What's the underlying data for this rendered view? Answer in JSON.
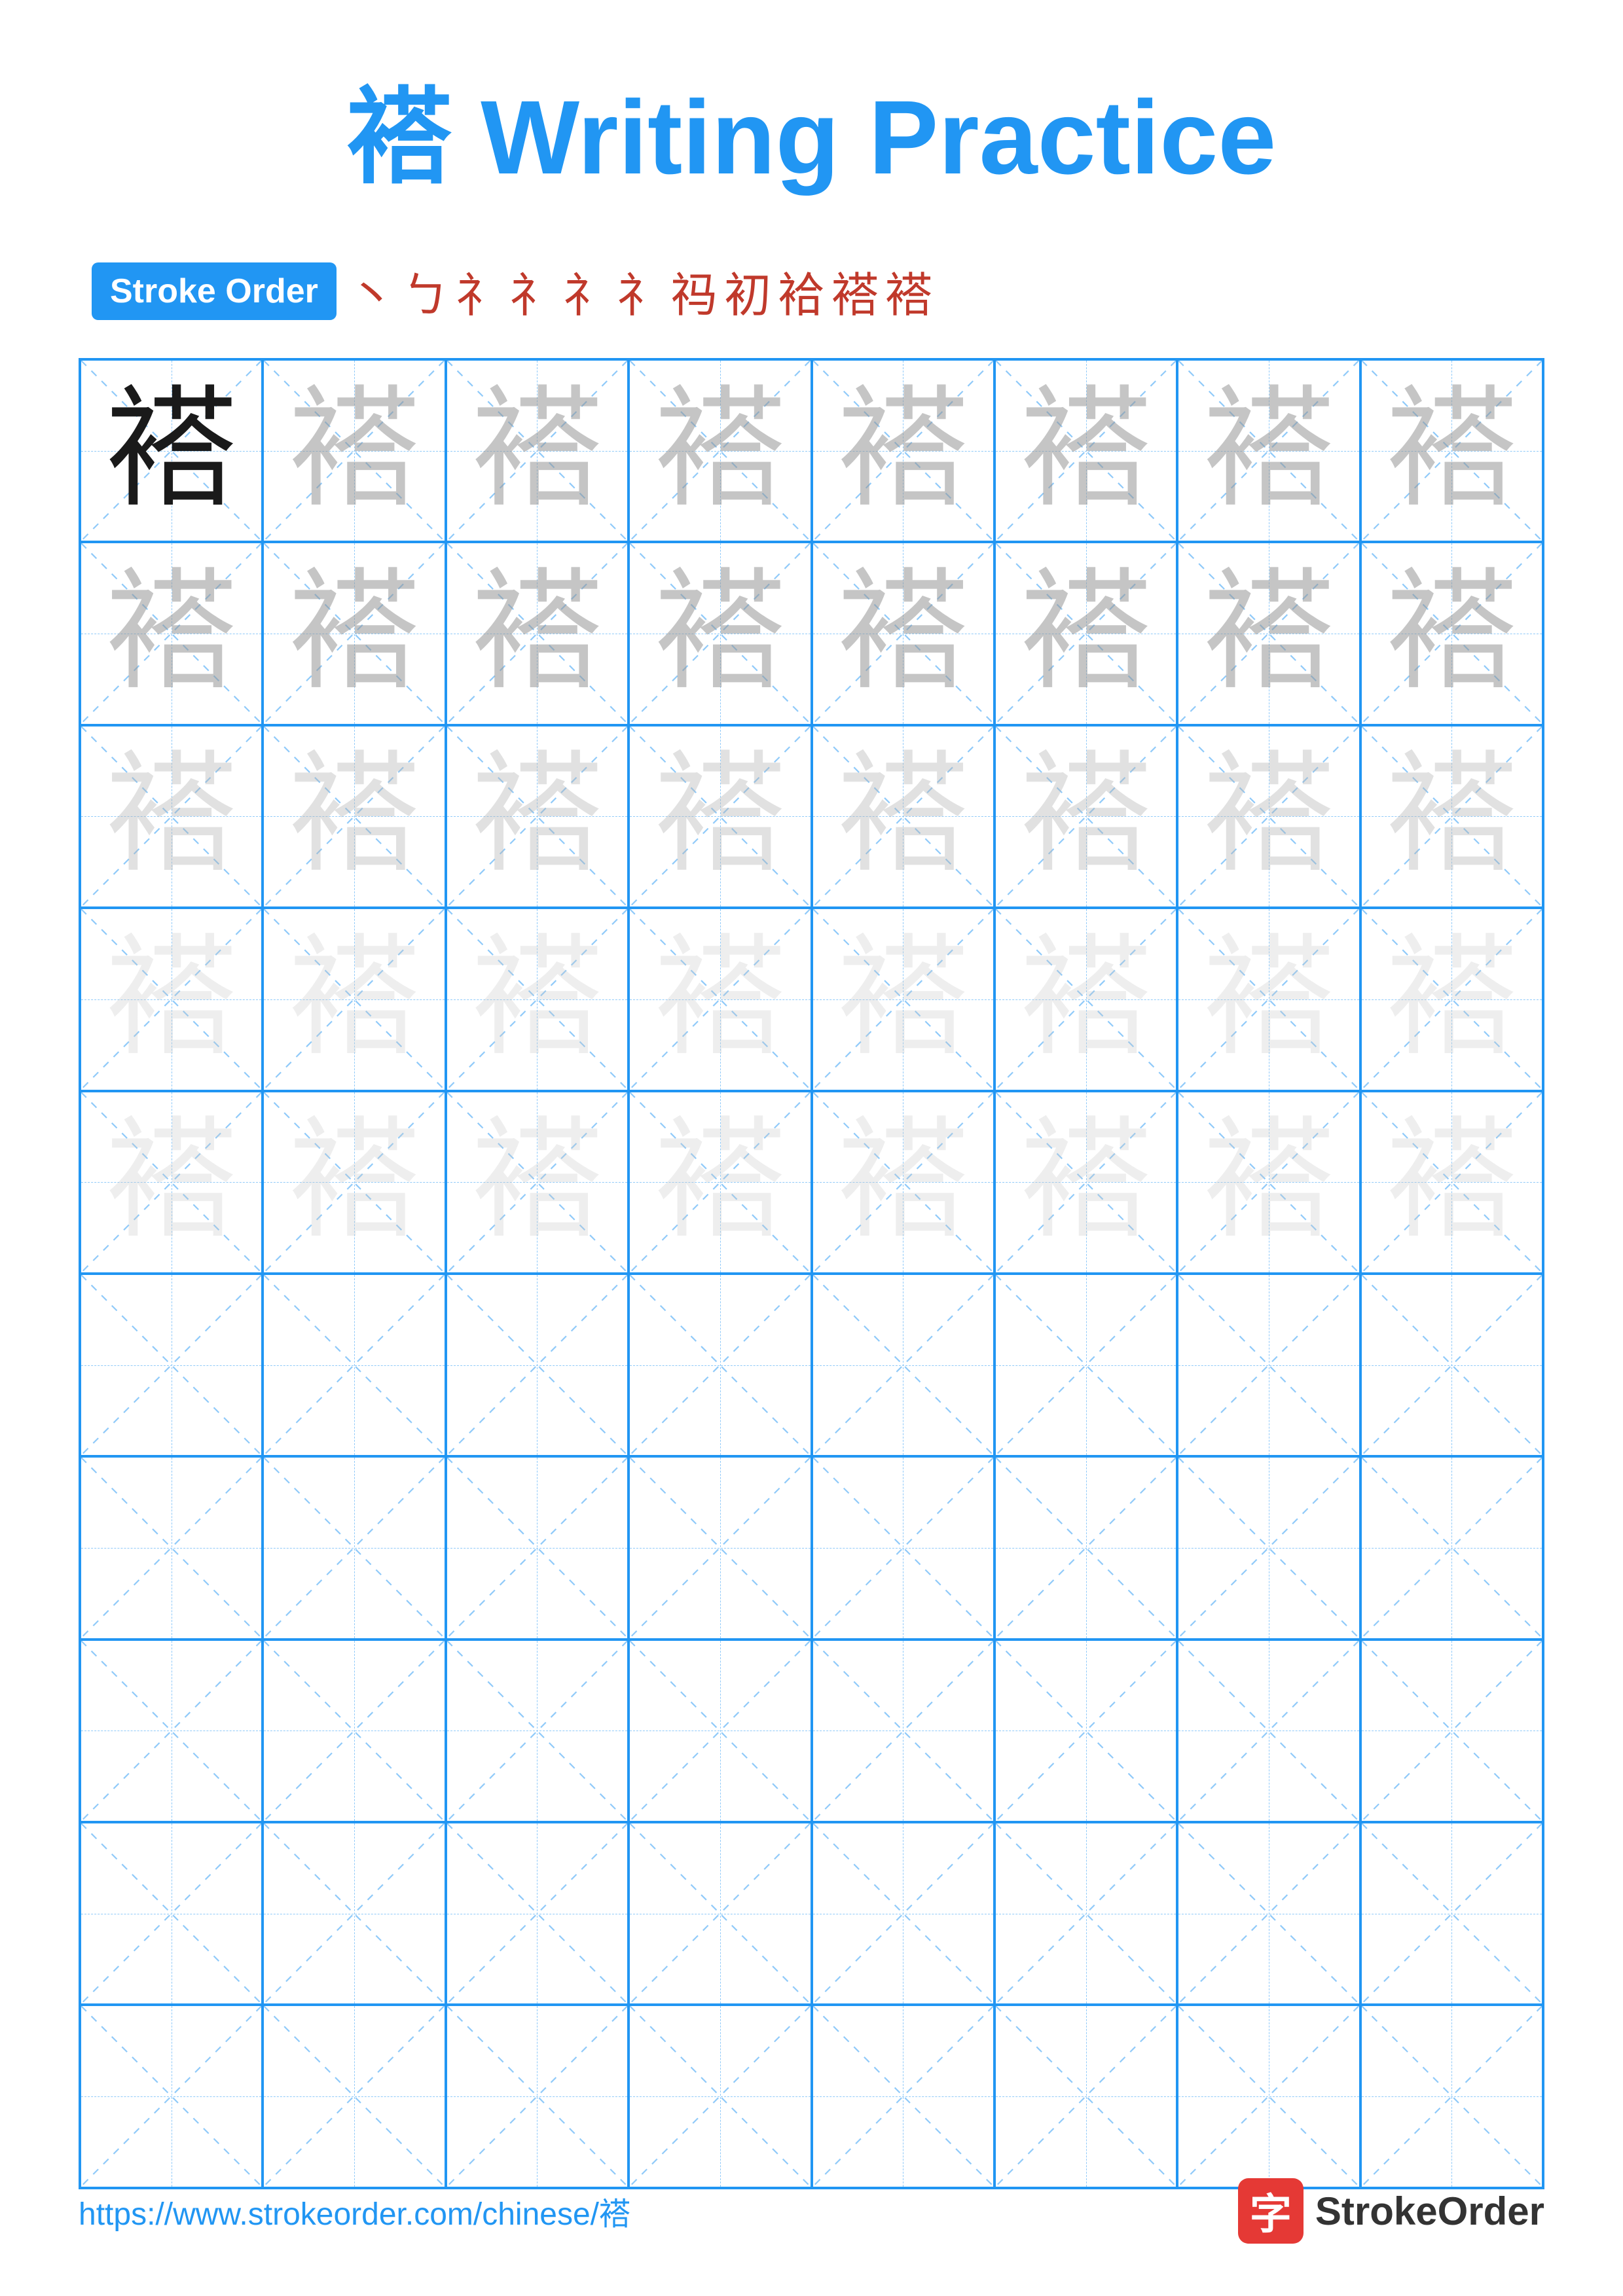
{
  "title": "褡 Writing Practice",
  "stroke_order": {
    "badge_label": "Stroke Order",
    "strokes": [
      "丶",
      "ㄅ",
      "礻",
      "礻",
      "礻",
      "礻",
      "祃",
      "初",
      "袷",
      "褡",
      "褡"
    ]
  },
  "character": "褡",
  "rows": [
    {
      "cells": [
        {
          "type": "solid"
        },
        {
          "type": "faint-1"
        },
        {
          "type": "faint-1"
        },
        {
          "type": "faint-1"
        },
        {
          "type": "faint-1"
        },
        {
          "type": "faint-1"
        },
        {
          "type": "faint-1"
        },
        {
          "type": "faint-1"
        }
      ]
    },
    {
      "cells": [
        {
          "type": "faint-1"
        },
        {
          "type": "faint-1"
        },
        {
          "type": "faint-1"
        },
        {
          "type": "faint-1"
        },
        {
          "type": "faint-1"
        },
        {
          "type": "faint-1"
        },
        {
          "type": "faint-1"
        },
        {
          "type": "faint-1"
        }
      ]
    },
    {
      "cells": [
        {
          "type": "faint-2"
        },
        {
          "type": "faint-2"
        },
        {
          "type": "faint-2"
        },
        {
          "type": "faint-2"
        },
        {
          "type": "faint-2"
        },
        {
          "type": "faint-2"
        },
        {
          "type": "faint-2"
        },
        {
          "type": "faint-2"
        }
      ]
    },
    {
      "cells": [
        {
          "type": "faint-3"
        },
        {
          "type": "faint-3"
        },
        {
          "type": "faint-3"
        },
        {
          "type": "faint-3"
        },
        {
          "type": "faint-3"
        },
        {
          "type": "faint-3"
        },
        {
          "type": "faint-3"
        },
        {
          "type": "faint-3"
        }
      ]
    },
    {
      "cells": [
        {
          "type": "faint-3"
        },
        {
          "type": "faint-3"
        },
        {
          "type": "faint-3"
        },
        {
          "type": "faint-3"
        },
        {
          "type": "faint-3"
        },
        {
          "type": "faint-3"
        },
        {
          "type": "faint-3"
        },
        {
          "type": "faint-3"
        }
      ]
    },
    {
      "cells": [
        {
          "type": "empty"
        },
        {
          "type": "empty"
        },
        {
          "type": "empty"
        },
        {
          "type": "empty"
        },
        {
          "type": "empty"
        },
        {
          "type": "empty"
        },
        {
          "type": "empty"
        },
        {
          "type": "empty"
        }
      ]
    },
    {
      "cells": [
        {
          "type": "empty"
        },
        {
          "type": "empty"
        },
        {
          "type": "empty"
        },
        {
          "type": "empty"
        },
        {
          "type": "empty"
        },
        {
          "type": "empty"
        },
        {
          "type": "empty"
        },
        {
          "type": "empty"
        }
      ]
    },
    {
      "cells": [
        {
          "type": "empty"
        },
        {
          "type": "empty"
        },
        {
          "type": "empty"
        },
        {
          "type": "empty"
        },
        {
          "type": "empty"
        },
        {
          "type": "empty"
        },
        {
          "type": "empty"
        },
        {
          "type": "empty"
        }
      ]
    },
    {
      "cells": [
        {
          "type": "empty"
        },
        {
          "type": "empty"
        },
        {
          "type": "empty"
        },
        {
          "type": "empty"
        },
        {
          "type": "empty"
        },
        {
          "type": "empty"
        },
        {
          "type": "empty"
        },
        {
          "type": "empty"
        }
      ]
    },
    {
      "cells": [
        {
          "type": "empty"
        },
        {
          "type": "empty"
        },
        {
          "type": "empty"
        },
        {
          "type": "empty"
        },
        {
          "type": "empty"
        },
        {
          "type": "empty"
        },
        {
          "type": "empty"
        },
        {
          "type": "empty"
        }
      ]
    }
  ],
  "footer": {
    "url": "https://www.strokeorder.com/chinese/褡",
    "logo_char": "字",
    "logo_text": "StrokeOrder"
  }
}
